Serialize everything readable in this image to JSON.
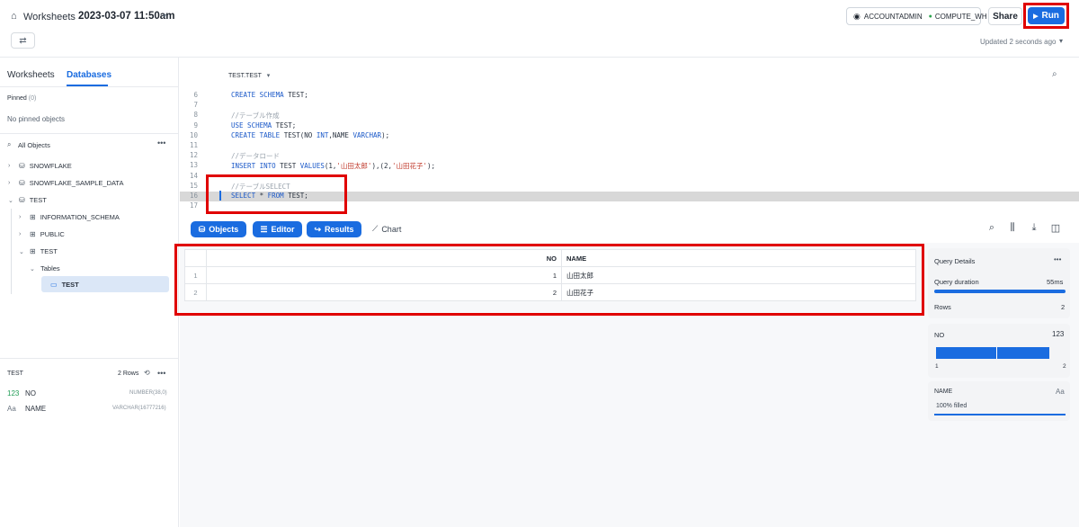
{
  "header": {
    "crumb": "Worksheets",
    "title": "2023-03-07 11:50am",
    "role": "ACCOUNTADMIN",
    "warehouse": "COMPUTE_WH",
    "share_label": "Share",
    "run_label": "Run",
    "updated": "Updated 2 seconds ago"
  },
  "sidebar": {
    "tabs": [
      "Worksheets",
      "Databases"
    ],
    "pinned_label": "Pinned",
    "pinned_count": "(0)",
    "no_pinned": "No pinned objects",
    "all_objects": "All Objects",
    "tree": [
      "SNOWFLAKE",
      "SNOWFLAKE_SAMPLE_DATA",
      "TEST",
      "INFORMATION_SCHEMA",
      "PUBLIC",
      "TEST",
      "Tables",
      "TEST"
    ],
    "detail_title": "TEST",
    "detail_rows": "2 Rows",
    "columns": [
      {
        "type": "123",
        "name": "NO",
        "dtype": "NUMBER(38,0)"
      },
      {
        "type": "Aa",
        "name": "NAME",
        "dtype": "VARCHAR(16777216)"
      }
    ]
  },
  "editor": {
    "context": "TEST.TEST",
    "lines": [
      {
        "n": "6",
        "t": "CREATE SCHEMA TEST;"
      },
      {
        "n": "7",
        "t": ""
      },
      {
        "n": "8",
        "t": "//テーブル作成"
      },
      {
        "n": "9",
        "t": "USE SCHEMA TEST;"
      },
      {
        "n": "10",
        "t": "CREATE TABLE TEST(NO INT,NAME VARCHAR);"
      },
      {
        "n": "11",
        "t": ""
      },
      {
        "n": "12",
        "t": "//データロード"
      },
      {
        "n": "13",
        "t": "INSERT INTO TEST VALUES(1,'山田太郎'),(2,'山田花子');"
      },
      {
        "n": "14",
        "t": ""
      },
      {
        "n": "15",
        "t": "//テーブルSELECT"
      },
      {
        "n": "16",
        "t": "SELECT * FROM TEST;"
      },
      {
        "n": "17",
        "t": ""
      }
    ]
  },
  "toolbar": {
    "objects": "Objects",
    "editor": "Editor",
    "results": "Results",
    "chart": "Chart"
  },
  "results": {
    "columns": [
      "NO",
      "NAME"
    ],
    "rows": [
      {
        "idx": "1",
        "no": "1",
        "name": "山田太郎"
      },
      {
        "idx": "2",
        "no": "2",
        "name": "山田花子"
      }
    ]
  },
  "details": {
    "title": "Query Details",
    "duration_label": "Query duration",
    "duration_value": "55ms",
    "rows_label": "Rows",
    "rows_value": "2",
    "no_label": "NO",
    "no_type": "123",
    "no_min": "1",
    "no_max": "2",
    "name_label": "NAME",
    "name_type": "Aa",
    "name_filled": "100% filled"
  }
}
